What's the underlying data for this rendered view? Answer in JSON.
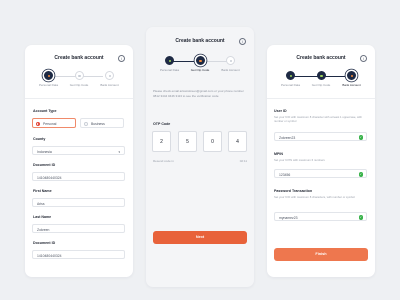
{
  "colors": {
    "accent": "#e8623a",
    "dark": "#1e2a44",
    "success": "#38b24a"
  },
  "screen1": {
    "title": "Create bank account",
    "steps": [
      {
        "label": "Personal Data",
        "state": "active"
      },
      {
        "label": "Get Otp Code",
        "state": "idle"
      },
      {
        "label": "Bank Account",
        "state": "idle"
      }
    ],
    "account_type_label": "Account Type",
    "account_type_options": [
      "Personal",
      "Business"
    ],
    "account_type_selected": "Personal",
    "county_label": "County",
    "county_value": "Indonesia",
    "doc_id_label": "Document ID",
    "doc_id_value": "1410480440324",
    "first_name_label": "First Name",
    "first_name_value": "Ariss",
    "last_name_label": "Last Name",
    "last_name_value": "Zokreen",
    "doc_id2_label": "Document ID",
    "doc_id2_value": "1410480440324"
  },
  "screen2": {
    "title": "Create bank account",
    "steps": [
      {
        "label": "Personal Data",
        "state": "done"
      },
      {
        "label": "Get Otp Code",
        "state": "active"
      },
      {
        "label": "Bank Account",
        "state": "idle"
      }
    ],
    "instructions": "Please check email arisszokreen@gmail.com or your phone number 0812 3444 0446 3113 to see the verification code",
    "otp_label": "OTP Code",
    "otp_digits": [
      "2",
      "5",
      "0",
      "4"
    ],
    "resend_label": "Resend code in",
    "resend_timer": "02:11",
    "next_label": "Next"
  },
  "screen3": {
    "title": "Create bank account",
    "steps": [
      {
        "label": "Personal Data",
        "state": "done"
      },
      {
        "label": "Get Otp Code",
        "state": "done"
      },
      {
        "label": "Bank Account",
        "state": "active"
      }
    ],
    "user_id_label": "User ID",
    "user_id_hint": "Set your 6 ID with maximum 8 character with at least 1 uppercase, with number or symbol",
    "user_id_value": "Zokreen23",
    "mpin_label": "MPIN",
    "mpin_hint": "Set your 6 PIN with maximum 6 numbers",
    "mpin_value": "123456",
    "pwd_label": "Password Transaction",
    "pwd_hint": "Set your 6 ID with maximum 8 characters, with number or symbol",
    "pwd_value": "mynamez23",
    "finish_label": "Finish"
  }
}
